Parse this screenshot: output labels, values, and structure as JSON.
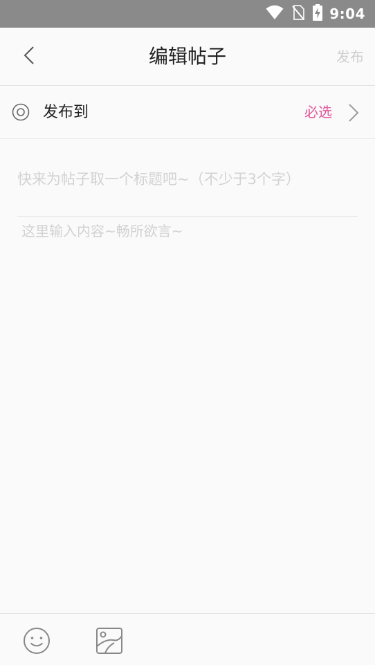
{
  "status_bar": {
    "time": "9:04",
    "icons": [
      "wifi-icon",
      "no-sim-icon",
      "battery-charging-icon"
    ]
  },
  "header": {
    "back_icon": "chevron-left-icon",
    "title": "编辑帖子",
    "publish_label": "发布"
  },
  "publish_to": {
    "icon": "target-icon",
    "label": "发布到",
    "required_label": "必选",
    "chevron_icon": "chevron-right-icon"
  },
  "editor": {
    "title_value": "",
    "title_placeholder": "快来为帖子取一个标题吧~（不少于3个字）",
    "content_value": "",
    "content_placeholder": "这里输入内容~畅所欲言~"
  },
  "toolbar": {
    "emoji_icon": "smiley-icon",
    "image_icon": "image-icon"
  },
  "colors": {
    "status_bar_bg": "#8a8a8a",
    "background": "#fafafa",
    "accent_required": "#e0559a",
    "publish_disabled": "#cfcfcf",
    "placeholder": "#d2d2d2"
  }
}
